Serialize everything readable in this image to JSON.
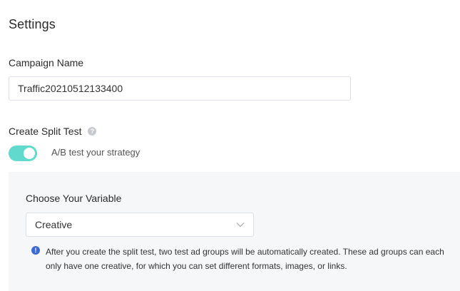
{
  "settings": {
    "title": "Settings"
  },
  "campaign": {
    "label": "Campaign Name",
    "value": "Traffic20210512133400"
  },
  "split_test": {
    "label": "Create Split Test",
    "help_icon": "question-icon",
    "toggle_on": true,
    "toggle_color": "#61d9cc",
    "description": "A/B test your strategy"
  },
  "variable": {
    "label": "Choose Your Variable",
    "selected": "Creative",
    "info_icon": "info-icon",
    "info_color": "#3d68d8",
    "info_text": "After you create the split test, two test ad groups will be automatically created. These ad groups can each only have one creative, for which you can set different formats, images, or links."
  }
}
